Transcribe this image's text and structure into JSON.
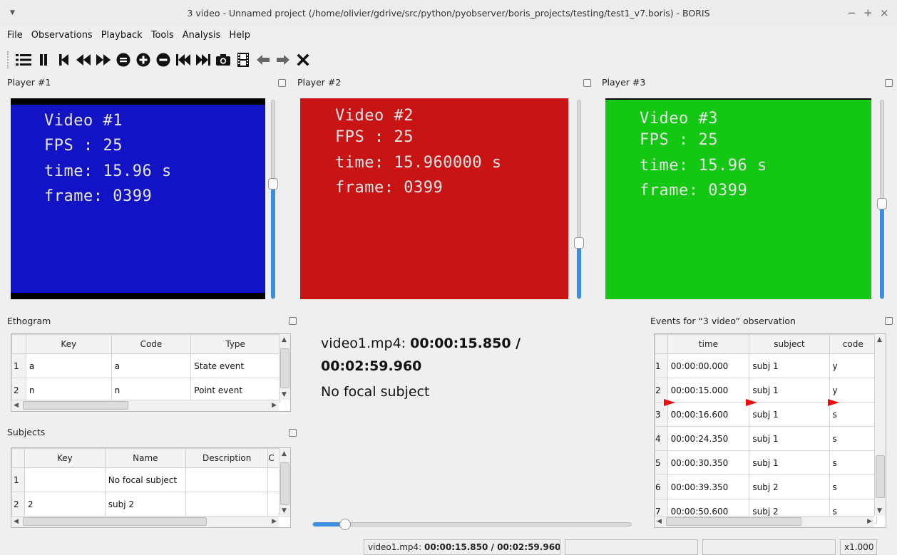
{
  "window": {
    "title": "3 video - Unnamed project (/home/olivier/gdrive/src/python/pyobserver/boris_projects/testing/test1_v7.boris) - BORIS"
  },
  "menu": [
    "File",
    "Observations",
    "Playback",
    "Tools",
    "Analysis",
    "Help"
  ],
  "toolbar_icons": [
    "list-icon",
    "pause-icon",
    "skip-to-start-icon",
    "rewind-icon",
    "fast-forward-icon",
    "decrease-speed-icon",
    "increase-speed-icon",
    "normal-speed-icon",
    "previous-media-icon",
    "next-media-icon",
    "snapshot-icon",
    "frame-by-frame-icon",
    "jump-back-icon",
    "jump-forward-icon",
    "close-observation-icon"
  ],
  "players": [
    {
      "label": "Player #1",
      "color": "#1313c6",
      "lines": [
        "Video #1",
        "FPS : 25",
        "time: 15.96 s",
        "frame: 0399"
      ],
      "volume": 0.58
    },
    {
      "label": "Player #2",
      "color": "#c81414",
      "lines": [
        "Video #2",
        "FPS : 25",
        "time: 15.960000 s",
        "frame: 0399"
      ],
      "volume": 0.28
    },
    {
      "label": "Player #3",
      "color": "#13c713",
      "lines": [
        "Video #3",
        "FPS : 25",
        "time: 15.96 s",
        "frame: 0399"
      ],
      "volume": 0.48
    }
  ],
  "ethogram": {
    "title": "Ethogram",
    "columns": [
      "Key",
      "Code",
      "Type"
    ],
    "rows": [
      {
        "n": "1",
        "key": "a",
        "code": "a",
        "type": "State event"
      },
      {
        "n": "2",
        "key": "n",
        "code": "n",
        "type": "Point event"
      }
    ]
  },
  "subjects": {
    "title": "Subjects",
    "columns": [
      "Key",
      "Name",
      "Description",
      "C"
    ],
    "rows": [
      {
        "n": "1",
        "key": "",
        "name": "No focal subject",
        "description": ""
      },
      {
        "n": "2",
        "key": "2",
        "name": "subj 2",
        "description": ""
      }
    ]
  },
  "media_info": {
    "file": "video1.mp4:",
    "time_line1": "00:00:15.850 /",
    "time_line2": "00:02:59.960",
    "focal": "No focal subject",
    "position": 0.1
  },
  "events": {
    "title": "Events for “3 video” observation",
    "columns": [
      "time",
      "subject",
      "code"
    ],
    "rows": [
      {
        "n": "1",
        "time": "00:00:00.000",
        "subject": "subj 1",
        "code": "y"
      },
      {
        "n": "2",
        "time": "00:00:15.000",
        "subject": "subj 1",
        "code": "y"
      },
      {
        "n": "3",
        "time": "00:00:16.600",
        "subject": "subj 1",
        "code": "s"
      },
      {
        "n": "4",
        "time": "00:00:24.350",
        "subject": "subj 1",
        "code": "s"
      },
      {
        "n": "5",
        "time": "00:00:30.350",
        "subject": "subj 1",
        "code": "s"
      },
      {
        "n": "6",
        "time": "00:00:39.350",
        "subject": "subj 2",
        "code": "s"
      },
      {
        "n": "7",
        "time": "00:00:50.600",
        "subject": "subj 2",
        "code": "s"
      }
    ]
  },
  "status": {
    "file": "video1.mp4:",
    "time": "00:00:15.850 / 00:02:59.960",
    "speed": "x1.000"
  }
}
